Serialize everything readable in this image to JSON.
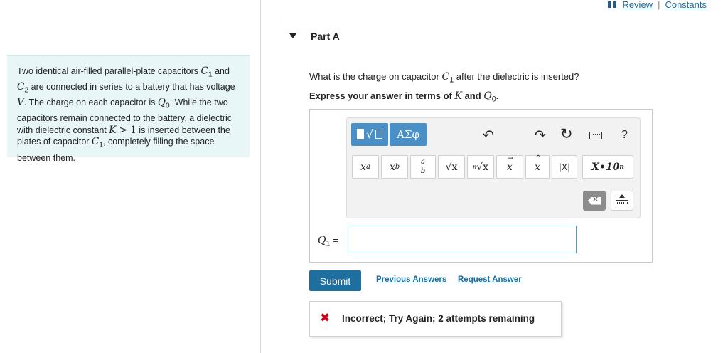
{
  "problem": {
    "text_parts": [
      "Two identical air-filled parallel-plate capacitors ",
      "C",
      "1",
      " and ",
      "C",
      "2",
      " are connected in series to a battery that has voltage ",
      "V",
      ". The charge on each capacitor is ",
      "Q",
      "0",
      ". While the two capacitors remain connected to the battery, a dielectric with dielectric constant ",
      "K",
      " > 1",
      " is inserted between the plates of capacitor ",
      "C",
      "1",
      ", completely filling the space between them."
    ]
  },
  "header": {
    "review_label": "Review",
    "constants_label": "Constants",
    "separator": "|"
  },
  "part": {
    "title": "Part A",
    "question": [
      "What is the charge on capacitor ",
      "C",
      "1",
      " after the dielectric is inserted?"
    ],
    "instruction": [
      "Express your answer in terms of ",
      "K",
      " and ",
      "Q",
      "0",
      "."
    ]
  },
  "toolbar": {
    "templates_icon": "templates-icon",
    "greek_label": "ΑΣφ",
    "undo_icon": "undo-icon",
    "redo_icon": "redo-icon",
    "reset_icon": "reset-icon",
    "keyboard_icon": "keyboard-icon",
    "help_label": "?",
    "buttons": {
      "superscript": [
        "x",
        "a"
      ],
      "subscript": [
        "x",
        "b"
      ],
      "fraction": [
        "a",
        "b"
      ],
      "sqrt": "√x",
      "nroot": [
        "n",
        "√x"
      ],
      "vector": "x",
      "unit_vector": "x",
      "abs": "|X|",
      "sci": [
        "X•10",
        "n"
      ]
    }
  },
  "answer": {
    "label_var": "Q",
    "label_sub": "1",
    "label_eq": " =",
    "value": ""
  },
  "actions": {
    "submit": "Submit",
    "previous_answers": "Previous Answers",
    "request_answer": "Request Answer"
  },
  "feedback": {
    "icon": "✖",
    "text": "Incorrect; Try Again; 2 attempts remaining",
    "color": "#d0021b"
  },
  "colors": {
    "accent": "#1e6f9f",
    "link": "#1a6fa3",
    "toolbar_blue": "#4a90c7",
    "problem_bg": "#e8f6f8"
  }
}
